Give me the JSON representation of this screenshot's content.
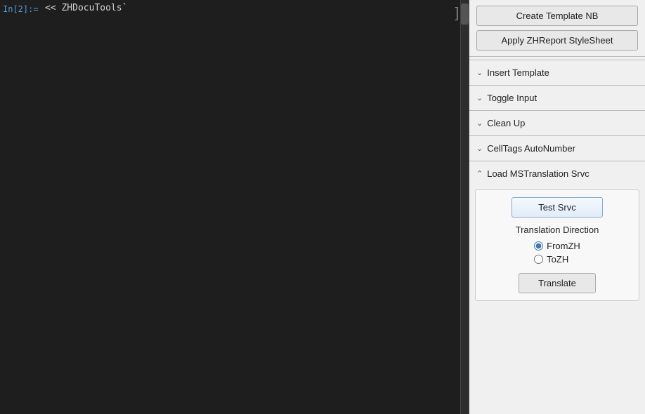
{
  "notebook": {
    "cell_label": "In[2]:=",
    "cell_content": "<< ZHDocuTools`"
  },
  "sidebar": {
    "buttons": {
      "create_template_nb": "Create Template NB",
      "apply_stylesheet": "Apply ZHReport StyleSheet"
    },
    "accordion": {
      "insert_template": "Insert Template",
      "toggle_input": "Toggle Input",
      "clean_up": "Clean Up",
      "celltags_autonumber": "CellTags AutoNumber",
      "load_ms_translation": "Load MSTranslation Srvc"
    },
    "ms_translation": {
      "test_srvc_label": "Test Srvc",
      "translation_direction_label": "Translation Direction",
      "from_zh_label": "FromZH",
      "to_zh_label": "ToZH",
      "translate_label": "Translate"
    }
  }
}
